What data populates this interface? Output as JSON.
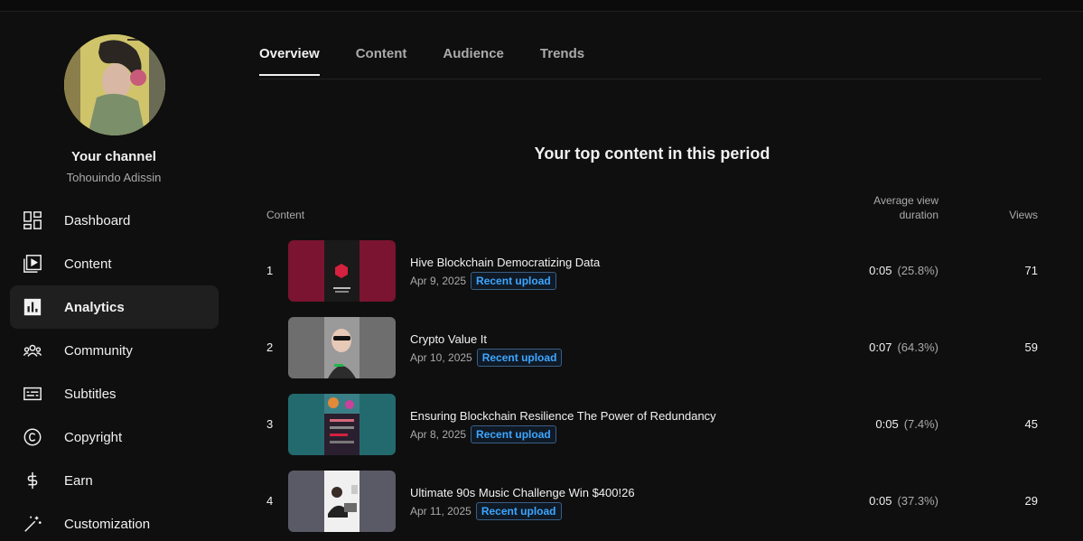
{
  "channel": {
    "title": "Your channel",
    "name": "Tohouindo Adissin"
  },
  "sidebar": {
    "items": [
      {
        "label": "Dashboard",
        "icon": "dashboard-icon"
      },
      {
        "label": "Content",
        "icon": "content-icon"
      },
      {
        "label": "Analytics",
        "icon": "analytics-icon",
        "active": true
      },
      {
        "label": "Community",
        "icon": "community-icon"
      },
      {
        "label": "Subtitles",
        "icon": "subtitles-icon"
      },
      {
        "label": "Copyright",
        "icon": "copyright-icon"
      },
      {
        "label": "Earn",
        "icon": "earn-icon"
      },
      {
        "label": "Customization",
        "icon": "customization-icon"
      }
    ]
  },
  "tabs": [
    {
      "label": "Overview",
      "active": true
    },
    {
      "label": "Content"
    },
    {
      "label": "Audience"
    },
    {
      "label": "Trends"
    }
  ],
  "top_content": {
    "title": "Your top content in this period",
    "headers": {
      "content": "Content",
      "avd": "Average view duration",
      "views": "Views"
    },
    "rows": [
      {
        "rank": "1",
        "title": "Hive Blockchain Democratizing Data",
        "date": "Apr 9, 2025",
        "badge": "Recent upload",
        "avd": "0:05",
        "avd_pct": "(25.8%)",
        "views": "71",
        "thumb_color": "#7a1430"
      },
      {
        "rank": "2",
        "title": "Crypto Value It",
        "date": "Apr 10, 2025",
        "badge": "Recent upload",
        "avd": "0:07",
        "avd_pct": "(64.3%)",
        "views": "59",
        "thumb_color": "#6e6e6e"
      },
      {
        "rank": "3",
        "title": "Ensuring Blockchain Resilience The Power of Redundancy",
        "date": "Apr 8, 2025",
        "badge": "Recent upload",
        "avd": "0:05",
        "avd_pct": "(7.4%)",
        "views": "45",
        "thumb_color": "#236a6e"
      },
      {
        "rank": "4",
        "title": "Ultimate 90s Music Challenge Win $400!26",
        "date": "Apr 11, 2025",
        "badge": "Recent upload",
        "avd": "0:05",
        "avd_pct": "(37.3%)",
        "views": "29",
        "thumb_color": "#5a5a66"
      }
    ]
  }
}
